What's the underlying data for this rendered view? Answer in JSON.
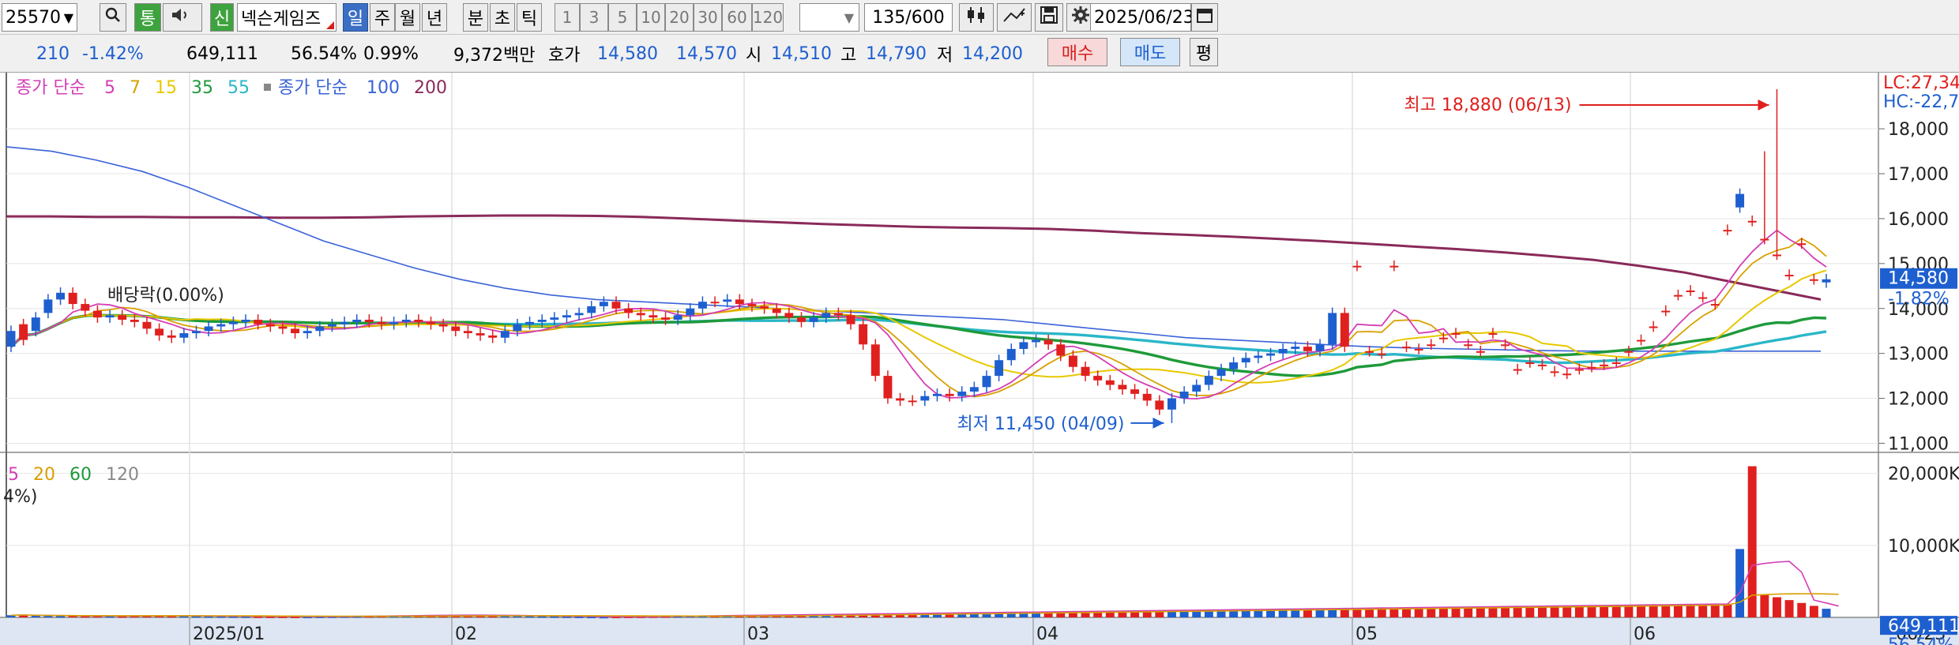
{
  "toolbar": {
    "code": "25570",
    "stock_name": "넥슨게임즈",
    "credit_badge": "신",
    "tong_btn": "통",
    "periods": [
      "일",
      "주",
      "월",
      "년",
      "분",
      "초",
      "틱"
    ],
    "active_period": "일",
    "minute_options": [
      "1",
      "3",
      "5",
      "10",
      "20",
      "30",
      "60",
      "120"
    ],
    "count": "135",
    "count_total": "/600",
    "date": "2025/06/23"
  },
  "quote": {
    "change": "210",
    "change_rate": "-1.42%",
    "volume": "649,111",
    "vol_rate": "56.54%",
    "turnover": "0.99%",
    "amount": "9,372백만",
    "ask_label": "호가",
    "ask": "14,580",
    "bid": "14,570",
    "open_label": "시",
    "open": "14,510",
    "high_label": "고",
    "high": "14,790",
    "low_label": "저",
    "low": "14,200",
    "buy_btn": "매수",
    "sell_btn": "매도",
    "eval_btn": "평"
  },
  "chart_data": {
    "type": "candlestick",
    "legend": {
      "ma_title": "종가 단순",
      "ma_periods": [
        "5",
        "7",
        "15",
        "35",
        "55"
      ],
      "ma_colors": [
        "#d43eb5",
        "#d8a000",
        "#e8c800",
        "#1e9a3a",
        "#2ab6c8"
      ],
      "ma2_title": "종가 단순",
      "ma2_periods": [
        "100",
        "200"
      ],
      "ma2_colors": [
        "#3a62d8",
        "#8a2a5a"
      ],
      "volume_mas": [
        "5",
        "20",
        "60",
        "120"
      ],
      "volume_ma_colors": [
        "#d43eb5",
        "#d8a000",
        "#1e9a3a",
        "#888888"
      ],
      "volume_note": "4%)"
    },
    "price_axis": {
      "ticks": [
        "18,000",
        "17,000",
        "16,000",
        "15,000",
        "14,000",
        "13,000",
        "12,000",
        "11,000"
      ],
      "ylim": [
        10850,
        19250
      ],
      "lc_label": "LC:27,34",
      "hc_label": "HC:-22,7",
      "current_price": "14,580",
      "current_change": "-1.82%"
    },
    "volume_axis": {
      "ticks": [
        "20,000K",
        "10,000K"
      ],
      "ylim": [
        0,
        21500
      ],
      "current_volume": "649,111",
      "current_rate": "56.54%"
    },
    "x_labels": [
      "2025/01",
      "02",
      "03",
      "04",
      "05",
      "06"
    ],
    "x_last_label": "06/23",
    "annotations": {
      "high": "최고 18,880 (06/13)",
      "low": "최저 11,450 (04/09)",
      "dividend": "배당락(0.00%)"
    },
    "candles_close": [
      13150,
      13650,
      13500,
      13900,
      14200,
      14350,
      14100,
      13950,
      13800,
      13850,
      13750,
      13700,
      13550,
      13400,
      13350,
      13450,
      13500,
      13600,
      13650,
      13700,
      13750,
      13650,
      13600,
      13550,
      13450,
      13500,
      13600,
      13650,
      13700,
      13750,
      13700,
      13650,
      13700,
      13750,
      13700,
      13650,
      13600,
      13500,
      13450,
      13400,
      13350,
      13500,
      13650,
      13700,
      13750,
      13800,
      13850,
      13900,
      14050,
      14150,
      14000,
      13900,
      13850,
      13800,
      13750,
      13850,
      14000,
      14150,
      14150,
      14200,
      14100,
      14050,
      14000,
      13900,
      13800,
      13700,
      13800,
      13900,
      13850,
      13650,
      13200,
      12500,
      12000,
      11950,
      11950,
      12050,
      12100,
      12050,
      12150,
      12250,
      12500,
      12850,
      13100,
      13250,
      13300,
      13200,
      12950,
      12700,
      12500,
      12400,
      12300,
      12200,
      12100,
      11950,
      11750,
      12000,
      12150,
      12300,
      12500,
      12650,
      12800,
      12900,
      12950,
      13000,
      13100,
      13150,
      13050,
      13200,
      13900,
      14950,
      13050,
      13000,
      14950,
      13150,
      13100,
      13200,
      13350,
      13450,
      13200,
      13050,
      13450,
      13200,
      12650,
      12800,
      12750,
      12600,
      12550,
      12650,
      12700,
      12750,
      12800,
      13050,
      13300,
      13600,
      13950,
      14300,
      14400,
      14250,
      14100,
      15750,
      16250,
      15950,
      15550,
      15200,
      14750,
      15450,
      14650,
      14580
    ],
    "candles_open": [
      13500,
      13300,
      13800,
      14200,
      14350,
      14100,
      13950,
      13800,
      13850,
      13750,
      13700,
      13550,
      13400,
      13350,
      13450,
      13500,
      13600,
      13650,
      13700,
      13750,
      13650,
      13600,
      13550,
      13450,
      13500,
      13600,
      13650,
      13700,
      13750,
      13700,
      13650,
      13700,
      13750,
      13700,
      13650,
      13600,
      13500,
      13450,
      13400,
      13350,
      13500,
      13650,
      13700,
      13750,
      13800,
      13850,
      13900,
      14050,
      14150,
      14000,
      13900,
      13850,
      13800,
      13750,
      13850,
      14000,
      14150,
      14150,
      14200,
      14100,
      14050,
      14000,
      13900,
      13800,
      13700,
      13800,
      13900,
      13850,
      13650,
      13200,
      12500,
      12000,
      11950,
      11950,
      12050,
      12100,
      12050,
      12150,
      12250,
      12500,
      12850,
      13100,
      13250,
      13300,
      13200,
      12950,
      12700,
      12500,
      12400,
      12300,
      12200,
      12100,
      11950,
      11750,
      12000,
      12150,
      12300,
      12500,
      12650,
      12800,
      12900,
      12950,
      13000,
      13100,
      13150,
      13050,
      13200,
      13900,
      13150,
      14950,
      13050,
      13000,
      14950,
      13150,
      13100,
      13200,
      13350,
      13450,
      13200,
      13050,
      13450,
      13200,
      12650,
      12800,
      12750,
      12600,
      12550,
      12650,
      12700,
      12750,
      12800,
      13050,
      13300,
      13600,
      13950,
      14300,
      14400,
      14250,
      14100,
      15750,
      16550,
      15950,
      15550,
      15200,
      14750,
      15450,
      14650
    ],
    "highlight_candles": {
      "spike_high": 18880,
      "spike_index": 143,
      "low_index": 94,
      "low_value": 11450
    },
    "ma100_line": [
      17600,
      17500,
      17300,
      17050,
      16700,
      16300,
      15900,
      15500,
      15200,
      14900,
      14650,
      14450,
      14300,
      14200,
      14150,
      14100,
      14050,
      14000,
      13950,
      13900,
      13850,
      13800,
      13750,
      13650,
      13550,
      13450,
      13350,
      13300,
      13250,
      13200,
      13150,
      13120,
      13100,
      13080,
      13060,
      13050,
      13050,
      13050,
      13050,
      13050,
      13050
    ],
    "ma200_line": [
      16050,
      16050,
      16040,
      16040,
      16030,
      16030,
      16020,
      16020,
      16030,
      16050,
      16060,
      16070,
      16070,
      16060,
      16040,
      16000,
      15960,
      15920,
      15880,
      15850,
      15820,
      15800,
      15790,
      15770,
      15730,
      15680,
      15640,
      15600,
      15550,
      15500,
      15440,
      15380,
      15320,
      15250,
      15170,
      15080,
      14950,
      14800,
      14600,
      14400,
      14200
    ],
    "ma_short_line": [
      13200,
      13600,
      13900,
      13950,
      13850,
      13700,
      13600,
      13550,
      13600,
      13650,
      13700,
      13750,
      13700,
      13600,
      13500,
      13650,
      13850,
      14000,
      14100,
      13950,
      13800,
      13750,
      13850,
      13900,
      13800,
      13600,
      13300,
      12700,
      12200,
      12050,
      12150,
      12400,
      12900,
      13200,
      12900,
      12500,
      12250,
      12000,
      12100,
      12500,
      12800
    ],
    "volume": [
      300,
      350,
      250,
      200,
      180,
      220,
      200,
      210,
      190,
      180,
      220,
      250,
      230,
      210,
      200,
      190,
      180,
      170,
      160,
      150,
      140,
      130,
      120,
      110,
      100,
      120,
      140,
      160,
      180,
      200,
      220,
      240,
      260,
      280,
      300,
      320,
      340,
      300,
      280,
      260,
      240,
      220,
      200,
      180,
      160,
      140,
      120,
      100,
      80,
      100,
      120,
      140,
      160,
      180,
      200,
      220,
      240,
      260,
      280,
      300,
      320,
      340,
      360,
      380,
      400,
      420,
      440,
      460,
      480,
      500,
      520,
      540,
      560,
      580,
      600,
      620,
      640,
      660,
      680,
      700,
      720,
      740,
      760,
      780,
      800,
      820,
      840,
      860,
      880,
      900,
      920,
      940,
      960,
      980,
      1000,
      1020,
      1040,
      1060,
      1080,
      1100,
      1120,
      1140,
      1160,
      1180,
      1200,
      1220,
      1240,
      1260,
      1280,
      1300,
      1320,
      1340,
      1360,
      1380,
      1400,
      1420,
      1440,
      1460,
      1480,
      1500,
      1520,
      1540,
      1560,
      1580,
      1600,
      1620,
      1640,
      1660,
      1680,
      1700,
      1720,
      1740,
      1760,
      1780,
      1800,
      1820,
      1840,
      1860,
      1880,
      1900,
      9500,
      21000,
      3200,
      2800,
      2400,
      2000,
      1600,
      1200,
      649
    ]
  }
}
